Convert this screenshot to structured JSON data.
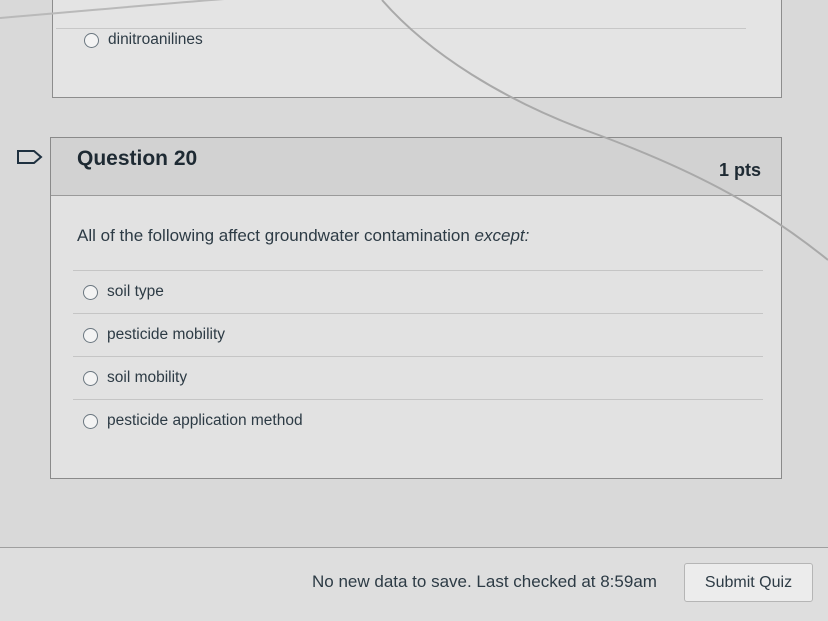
{
  "previous_question": {
    "option_label": "dinitroanilines"
  },
  "question": {
    "title": "Question 20",
    "points": "1 pts",
    "text_main": "All of the following affect groundwater contamination ",
    "text_emphasis": "except:",
    "answers": [
      {
        "label": "soil type"
      },
      {
        "label": "pesticide mobility"
      },
      {
        "label": "soil mobility"
      },
      {
        "label": "pesticide application method"
      }
    ]
  },
  "footer": {
    "save_status": "No new data to save. Last checked at 8:59am",
    "submit_label": "Submit Quiz"
  },
  "icons": {
    "flag": "flag-icon",
    "radio": "radio-icon"
  },
  "colors": {
    "text": "#2d3b45",
    "header_bg": "#d2d2d2",
    "card_bg": "#e2e2e2"
  }
}
